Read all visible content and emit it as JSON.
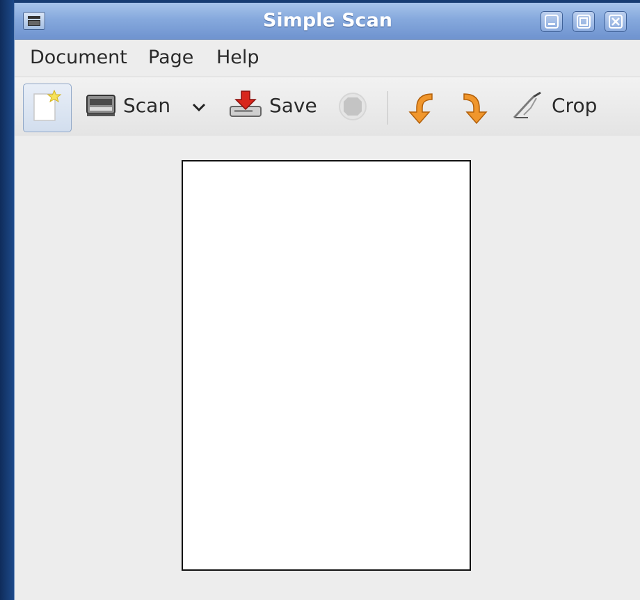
{
  "window": {
    "title": "Simple Scan",
    "controls": [
      "minimize-icon",
      "maximize-icon",
      "close-icon"
    ]
  },
  "menubar": {
    "items": [
      {
        "label": "Document"
      },
      {
        "label": "Page"
      },
      {
        "label": "Help"
      }
    ]
  },
  "toolbar": {
    "new_icon": "new-document-icon",
    "scan_label": "Scan",
    "scan_icon": "scanner-icon",
    "scan_dropdown_icon": "chevron-down-icon",
    "save_label": "Save",
    "save_icon": "save-icon",
    "stop_icon": "stop-icon",
    "rotate_left_icon": "rotate-left-icon",
    "rotate_right_icon": "rotate-right-icon",
    "crop_label": "Crop",
    "crop_icon": "crop-icon"
  },
  "colors": {
    "titlebar": "#86a9dd",
    "window_bg": "#ededed",
    "page": "#ffffff",
    "rotate_arrows": "#f0962c",
    "save_arrow": "#d8261c"
  }
}
